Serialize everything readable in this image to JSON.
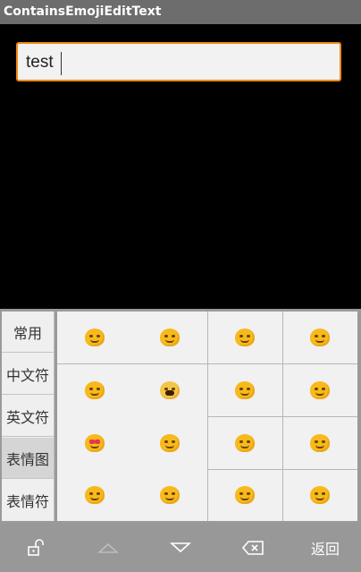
{
  "app": {
    "title": "ContainsEmojiEditText"
  },
  "edit": {
    "value": "test"
  },
  "keyboard": {
    "sidebar": [
      {
        "label": "常用"
      },
      {
        "label": "中文符"
      },
      {
        "label": "英文符"
      },
      {
        "label": "表情图"
      },
      {
        "label": "表情符"
      }
    ],
    "active_index": 3,
    "emoji_rows": 4,
    "emoji_cols": 4
  },
  "nav": {
    "back_label": "返回"
  },
  "colors": {
    "accent": "#f08a12",
    "emoji": "#f7b91c",
    "titlebar": "#6d6d6d"
  }
}
